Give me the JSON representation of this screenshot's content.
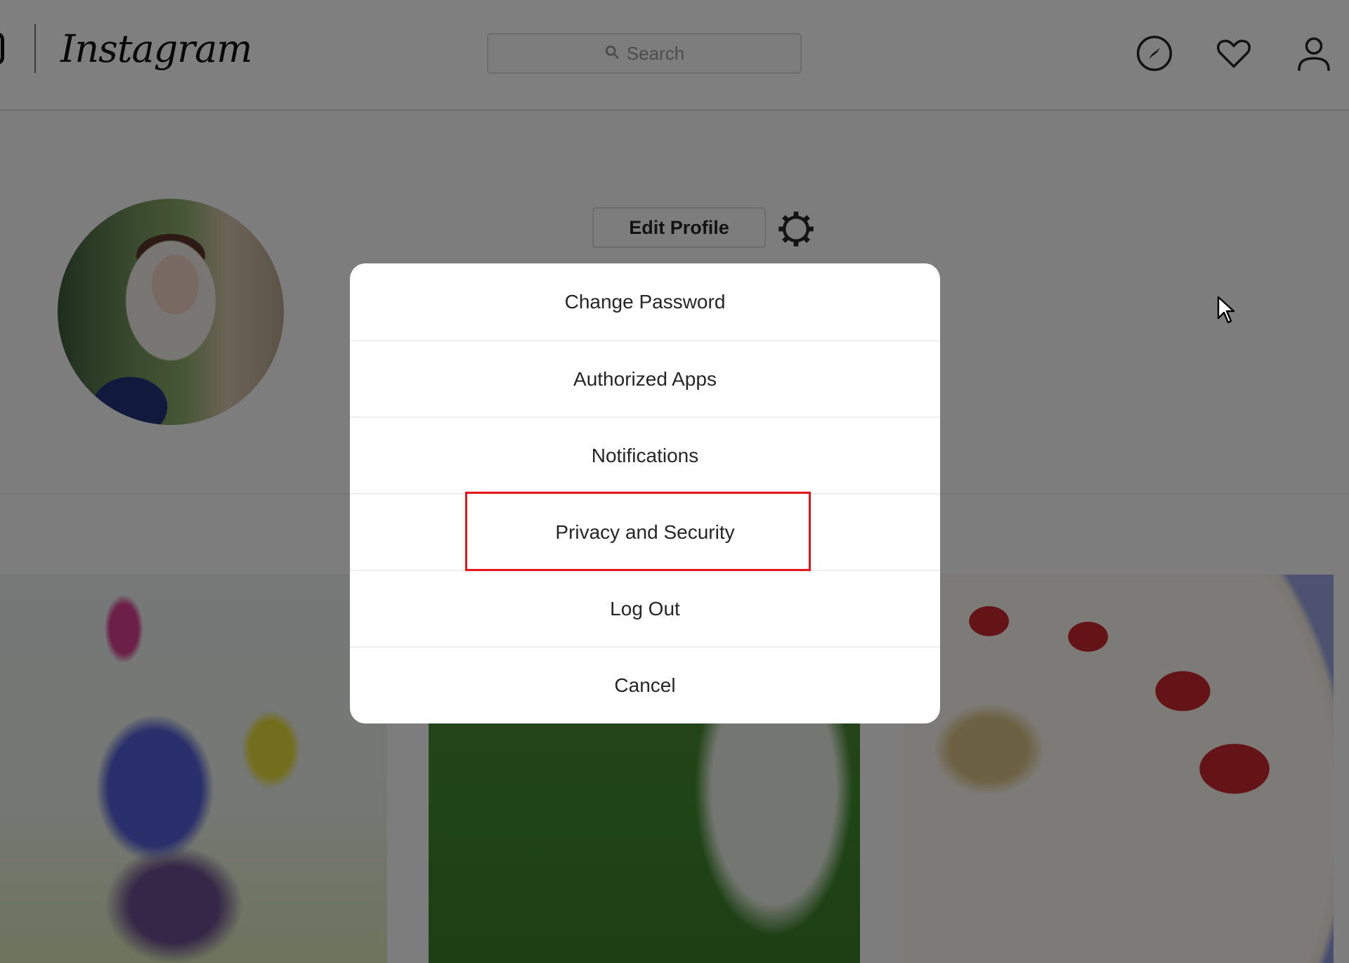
{
  "header": {
    "logo": "Instagram",
    "search": {
      "placeholder": "Search",
      "icon": "search-icon"
    },
    "nav_icons": [
      "compass-icon",
      "heart-icon",
      "user-icon"
    ]
  },
  "profile": {
    "edit_profile_label": "Edit Profile",
    "settings_icon": "gear-icon"
  },
  "posts": [
    "wildflower bouquet",
    "garden with white hydrangea",
    "dessert bowl with strawberries and nuts"
  ],
  "settings_menu": {
    "items": [
      {
        "label": "Change Password"
      },
      {
        "label": "Authorized Apps"
      },
      {
        "label": "Notifications"
      },
      {
        "label": "Privacy and Security",
        "highlighted": true
      },
      {
        "label": "Log Out"
      },
      {
        "label": "Cancel"
      }
    ],
    "highlight_color": "#e8141c"
  },
  "colors": {
    "overlay": "#7f7f7f",
    "text": "#262626",
    "divider": "#efefef"
  }
}
